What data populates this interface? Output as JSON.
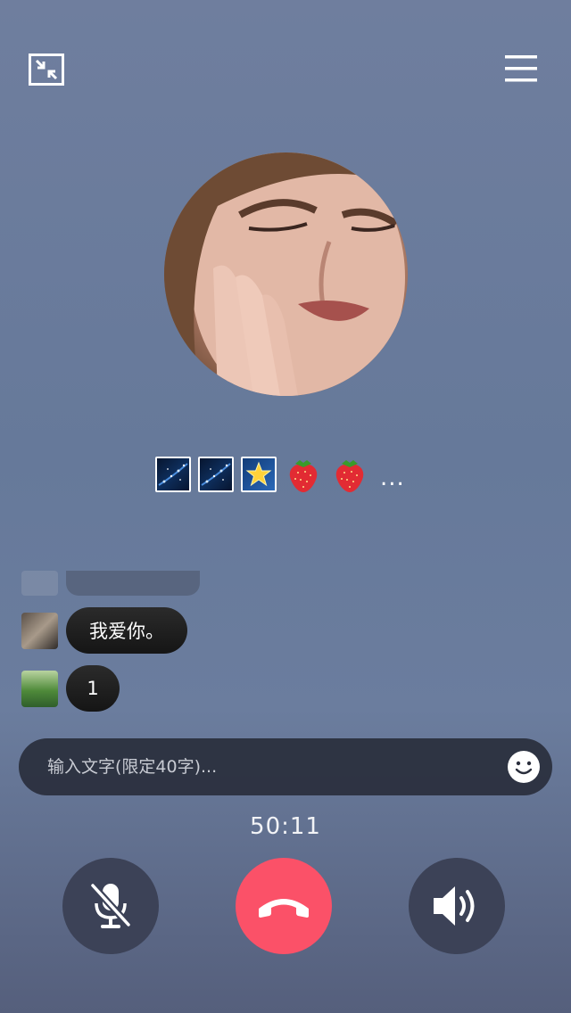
{
  "header": {
    "minimize_icon": "minimize-icon",
    "menu_icon": "menu-icon"
  },
  "gifts": {
    "items": [
      "stars-gift",
      "stars-gift",
      "star-gift",
      "strawberry-gift",
      "strawberry-gift"
    ],
    "strawberry": "🍓",
    "more_label": "..."
  },
  "chat": {
    "messages": [
      {
        "text": "我爱你。"
      },
      {
        "text": "1"
      }
    ]
  },
  "input": {
    "placeholder": "输入文字(限定40字)..."
  },
  "call": {
    "timer": "50:11"
  },
  "colors": {
    "hangup": "#fb5168",
    "control_bg": "#3c4257"
  }
}
